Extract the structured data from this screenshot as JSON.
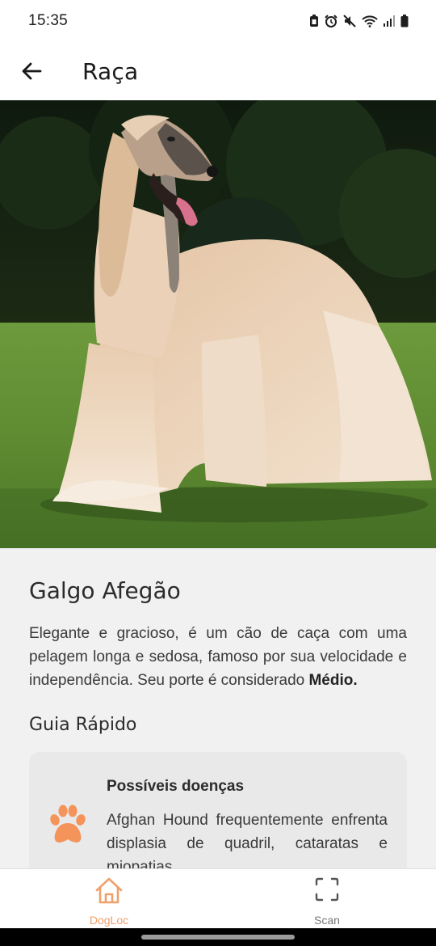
{
  "status_bar": {
    "time": "15:35"
  },
  "app_bar": {
    "title": "Raça"
  },
  "breed": {
    "name": "Galgo Afegão",
    "description": "Elegante e gracioso, é um cão de caça com uma pelagem longa e sedosa, famoso por sua velocidade e independência. Seu porte é considerado ",
    "size": "Médio."
  },
  "quick_guide": {
    "title": "Guia Rápido",
    "cards": [
      {
        "icon": "paw-icon",
        "title": "Possíveis doenças",
        "text": "Afghan Hound frequentemente enfrenta displasia de quadril, cataratas e miopatias."
      }
    ]
  },
  "bottom_nav": {
    "items": [
      {
        "label": "DogLoc",
        "icon": "home-icon",
        "active": true
      },
      {
        "label": "Scan",
        "icon": "scan-icon",
        "active": false
      }
    ]
  },
  "colors": {
    "accent": "#f0a06b",
    "paw": "#f4935a"
  }
}
